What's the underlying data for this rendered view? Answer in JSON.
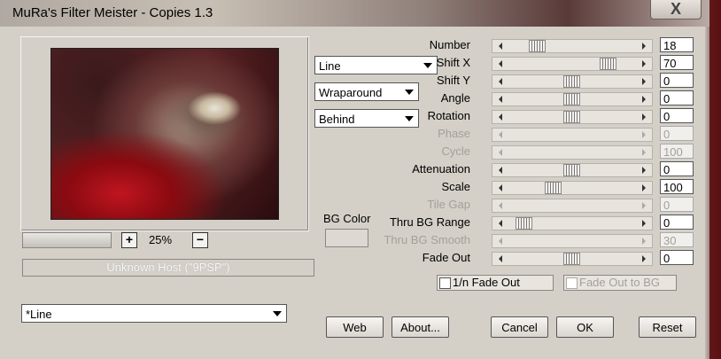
{
  "window": {
    "title": "MuRa's Filter Meister - Copies 1.3",
    "close_label": "X"
  },
  "preview": {
    "zoom_level": "25%",
    "zoom_plus": "+",
    "zoom_minus": "−",
    "host_text": "Unknown Host (\"9PSP\")"
  },
  "dropdowns": {
    "mode": "Line",
    "edge": "Wraparound",
    "order": "Behind",
    "preset": "*Line"
  },
  "bg_color_label": "BG Color",
  "params": [
    {
      "label": "Number",
      "value": "18",
      "enabled": true,
      "slider_fraction": 0.18
    },
    {
      "label": "Shift X",
      "value": "70",
      "enabled": true,
      "slider_fraction": 0.85
    },
    {
      "label": "Shift Y",
      "value": "0",
      "enabled": true,
      "slider_fraction": 0.5
    },
    {
      "label": "Angle",
      "value": "0",
      "enabled": true,
      "slider_fraction": 0.5
    },
    {
      "label": "Rotation",
      "value": "0",
      "enabled": true,
      "slider_fraction": 0.5
    },
    {
      "label": "Phase",
      "value": "0",
      "enabled": false,
      "slider_fraction": null
    },
    {
      "label": "Cycle",
      "value": "100",
      "enabled": false,
      "slider_fraction": null
    },
    {
      "label": "Attenuation",
      "value": "0",
      "enabled": true,
      "slider_fraction": 0.5
    },
    {
      "label": "Scale",
      "value": "100",
      "enabled": true,
      "slider_fraction": 0.33
    },
    {
      "label": "Tile Gap",
      "value": "0",
      "enabled": false,
      "slider_fraction": null
    },
    {
      "label": "Thru BG Range",
      "value": "0",
      "enabled": true,
      "slider_fraction": 0.05
    },
    {
      "label": "Thru BG Smooth",
      "value": "30",
      "enabled": false,
      "slider_fraction": null
    },
    {
      "label": "Fade Out",
      "value": "0",
      "enabled": true,
      "slider_fraction": 0.5
    }
  ],
  "checkboxes": {
    "fade_out_label": "1/n Fade Out",
    "fade_out_to_bg_label": "Fade Out to BG"
  },
  "buttons": {
    "web": "Web",
    "about": "About...",
    "cancel": "Cancel",
    "ok": "OK",
    "reset": "Reset"
  }
}
